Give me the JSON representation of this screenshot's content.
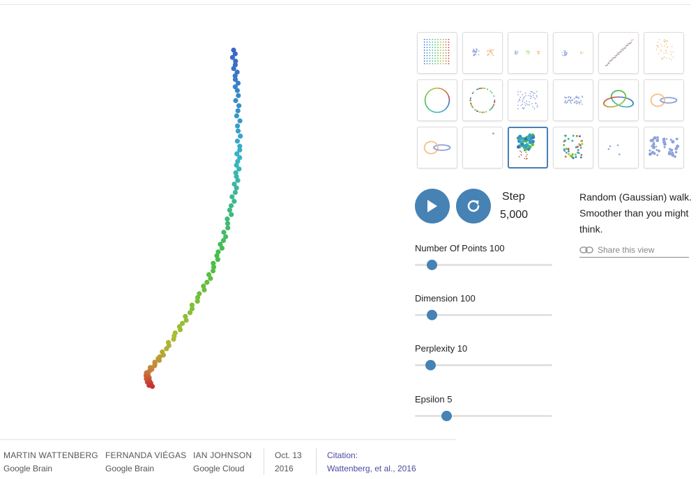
{
  "controls": {
    "step_label": "Step",
    "step_value": "5,000",
    "play_icon": "play-icon",
    "reset_icon": "refresh-icon"
  },
  "sliders": [
    {
      "label": "Number Of Points 100",
      "position": 0.12
    },
    {
      "label": "Dimension 100",
      "position": 0.12
    },
    {
      "label": "Perplexity 10",
      "position": 0.11
    },
    {
      "label": "Epsilon 5",
      "position": 0.23
    }
  ],
  "description": {
    "text": "Random (Gaussian) walk. Smoother than you might think.",
    "share_label": "Share this view",
    "share_icon": "link-icon"
  },
  "footer": {
    "authors": [
      {
        "name": "MARTIN WATTENBERG",
        "affiliation": "Google Brain"
      },
      {
        "name": "FERNANDA VIÉGAS",
        "affiliation": "Google Brain"
      },
      {
        "name": "IAN JOHNSON",
        "affiliation": "Google Cloud"
      }
    ],
    "date_line1": "Oct. 13",
    "date_line2": "2016",
    "citation_label": "Citation:",
    "citation_text": "Wattenberg, et al., 2016"
  },
  "thumbnails": [
    "grid",
    "two-clusters",
    "three-clusters",
    "two-clusters-unequal",
    "two-long-lines",
    "cluster-in-cluster",
    "circle-evenly-spaced",
    "circle-randomly-spaced",
    "gaussian-cloud",
    "ellipsoidal-cloud",
    "trefoil-knot",
    "linked-rings",
    "unlinked-rings",
    "orthogonal-steps",
    "random-walk",
    "random-jump",
    "simplex",
    "uneven-squares"
  ],
  "selected_thumbnail": "random-walk",
  "colors": {
    "accent": "#4682b4",
    "selected_border": "#4a7fb5",
    "link": "#4a4aa0"
  }
}
